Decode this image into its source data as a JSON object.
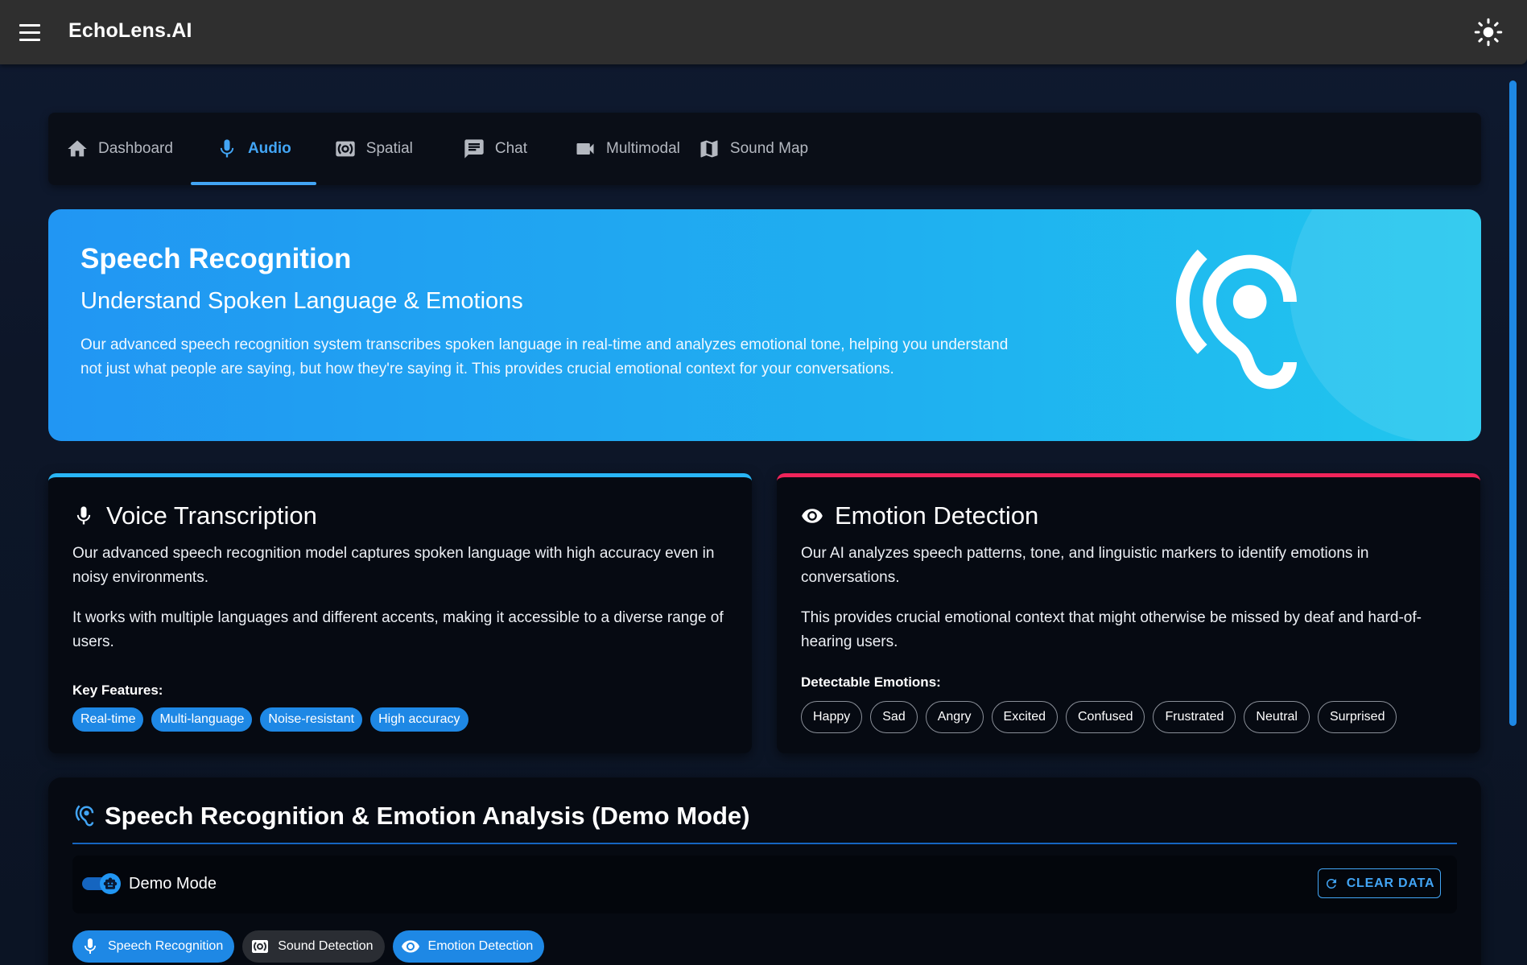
{
  "app": {
    "title": "EchoLens.AI"
  },
  "tabs": [
    {
      "label": "Dashboard",
      "icon": "home-icon"
    },
    {
      "label": "Audio",
      "icon": "mic-icon",
      "active": true
    },
    {
      "label": "Spatial",
      "icon": "surround-sound-icon"
    },
    {
      "label": "Chat",
      "icon": "chat-icon"
    },
    {
      "label": "Multimodal",
      "icon": "videocam-icon"
    },
    {
      "label": "Sound Map",
      "icon": "map-icon"
    }
  ],
  "hero": {
    "title": "Speech Recognition",
    "subtitle": "Understand Spoken Language & Emotions",
    "description": "Our advanced speech recognition system transcribes spoken language in real-time and analyzes emotional tone, helping you understand not just what people are saying, but how they're saying it. This provides crucial emotional context for your conversations.",
    "icon": "hearing-icon"
  },
  "voice_card": {
    "title": "Voice Transcription",
    "p1": "Our advanced speech recognition model captures spoken language with high accuracy even in noisy environments.",
    "p2": "It works with multiple languages and different accents, making it accessible to a diverse range of users.",
    "features_label": "Key Features:",
    "features": [
      "Real-time",
      "Multi-language",
      "Noise-resistant",
      "High accuracy"
    ],
    "accent": "#29b6f6"
  },
  "emotion_card": {
    "title": "Emotion Detection",
    "p1": "Our AI analyzes speech patterns, tone, and linguistic markers to identify emotions in conversations.",
    "p2": "This provides crucial emotional context that might otherwise be missed by deaf and hard-of-hearing users.",
    "emotions_label": "Detectable Emotions:",
    "emotions": [
      "Happy",
      "Sad",
      "Angry",
      "Excited",
      "Confused",
      "Frustrated",
      "Neutral",
      "Surprised"
    ],
    "accent": "#f0245a"
  },
  "demo": {
    "title": "Speech Recognition & Emotion Analysis (Demo Mode)",
    "toggle_label": "Demo Mode",
    "toggle_on": true,
    "clear_label": "CLEAR DATA",
    "modes": [
      {
        "label": "Speech Recognition",
        "active": true,
        "icon": "mic-icon"
      },
      {
        "label": "Sound Detection",
        "active": false,
        "icon": "surround-sound-icon"
      },
      {
        "label": "Emotion Detection",
        "active": true,
        "icon": "eye-icon"
      }
    ]
  },
  "colors": {
    "accent": "#42a5f5",
    "hero_start": "#2196f3",
    "hero_end": "#20c7ee",
    "bg": "#0f1a30"
  }
}
